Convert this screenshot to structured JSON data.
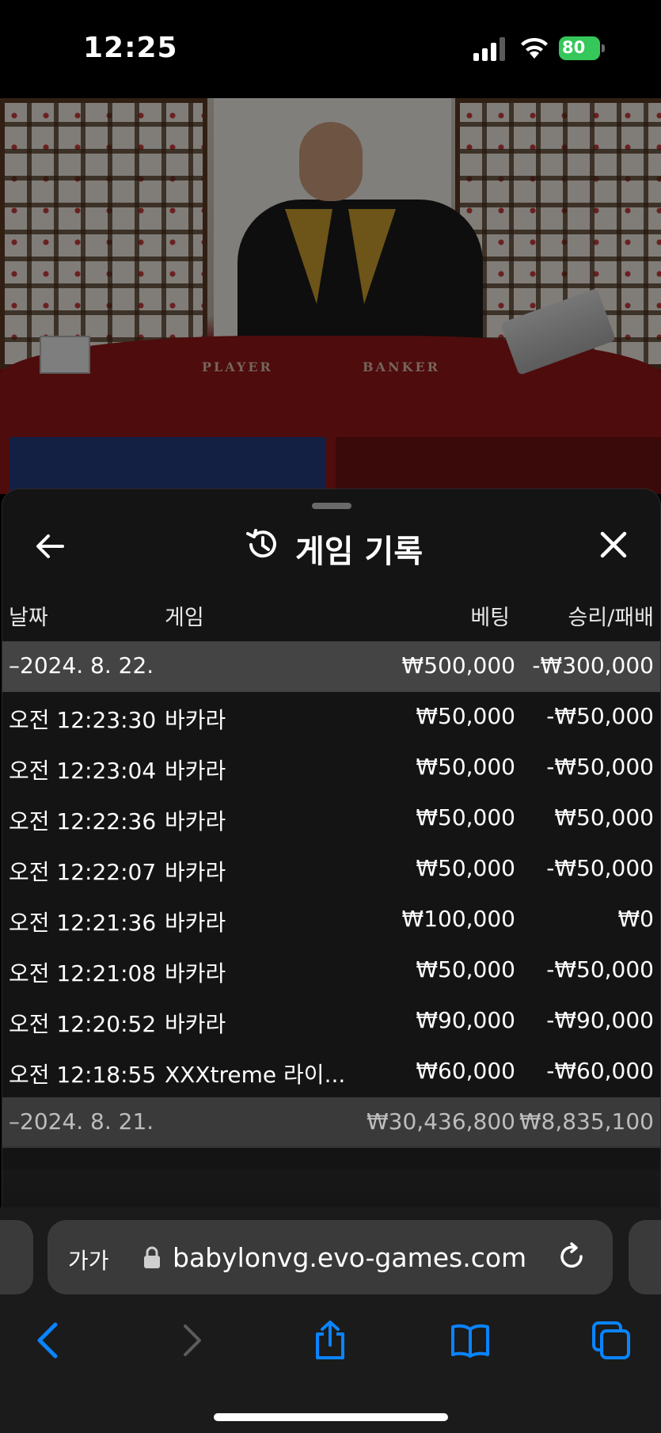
{
  "status_bar": {
    "time": "12:25",
    "battery": "80"
  },
  "video": {
    "table_labels": [
      "PLAYER",
      "BANKER"
    ]
  },
  "sheet": {
    "title": "게임 기록",
    "columns": {
      "date": "날짜",
      "game": "게임",
      "bet": "베팅",
      "win_loss": "승리/패배"
    },
    "rows": [
      {
        "type": "group",
        "date": "–2024. 8. 22.",
        "game": "",
        "bet": "₩500,000",
        "win_loss": "-₩300,000"
      },
      {
        "type": "item",
        "date": "오전 12:23:30",
        "game": "바카라",
        "bet": "₩50,000",
        "win_loss": "-₩50,000"
      },
      {
        "type": "item",
        "date": "오전 12:23:04",
        "game": "바카라",
        "bet": "₩50,000",
        "win_loss": "-₩50,000"
      },
      {
        "type": "item",
        "date": "오전 12:22:36",
        "game": "바카라",
        "bet": "₩50,000",
        "win_loss": "₩50,000"
      },
      {
        "type": "item",
        "date": "오전 12:22:07",
        "game": "바카라",
        "bet": "₩50,000",
        "win_loss": "-₩50,000"
      },
      {
        "type": "item",
        "date": "오전 12:21:36",
        "game": "바카라",
        "bet": "₩100,000",
        "win_loss": "₩0"
      },
      {
        "type": "item",
        "date": "오전 12:21:08",
        "game": "바카라",
        "bet": "₩50,000",
        "win_loss": "-₩50,000"
      },
      {
        "type": "item",
        "date": "오전 12:20:52",
        "game": "바카라",
        "bet": "₩90,000",
        "win_loss": "-₩90,000"
      },
      {
        "type": "item",
        "date": "오전 12:18:55",
        "game": "XXXtreme 라이...",
        "bet": "₩60,000",
        "win_loss": "-₩60,000"
      },
      {
        "type": "group",
        "date": "–2024. 8. 21.",
        "game": "",
        "bet": "₩30,436,800",
        "win_loss": "₩8,835,100"
      }
    ]
  },
  "browser": {
    "text_size_label": "가가",
    "url": "babylonvg.evo-games.com"
  },
  "colors": {
    "battery_green": "#35c759",
    "ios_blue": "#0a84ff",
    "sheet_bg": "#141414",
    "group_row_bg": "#444444"
  }
}
